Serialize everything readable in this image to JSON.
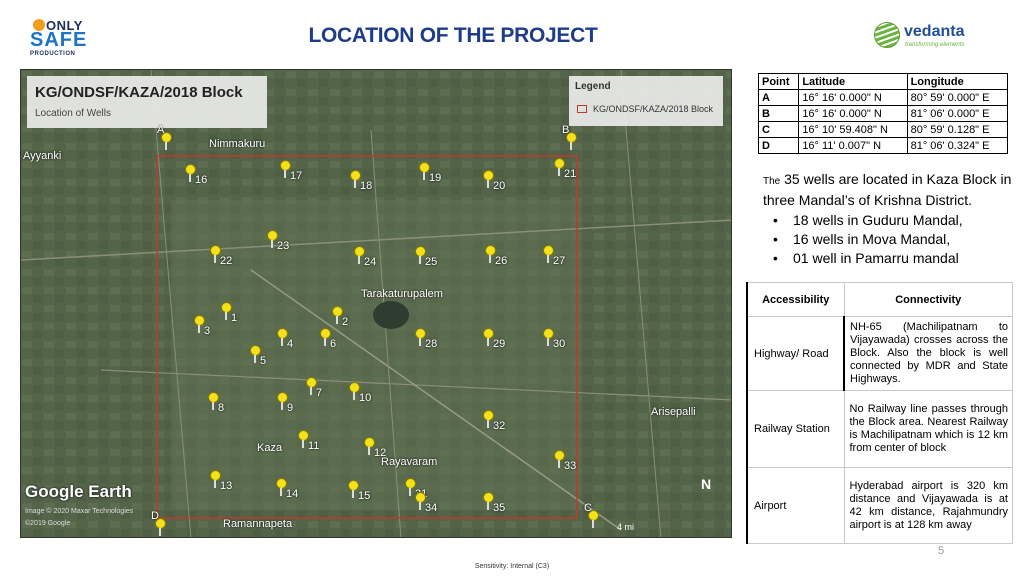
{
  "header": {
    "title": "LOCATION OF THE PROJECT",
    "logo_left": {
      "line1": "ONLY",
      "line2": "SAFE",
      "line3": "PRODUCTION"
    },
    "logo_right": {
      "brand": "vedanta",
      "tagline": "transforming elements"
    }
  },
  "map": {
    "title": "KG/ONDSF/KAZA/2018 Block",
    "subtitle": "Location of Wells",
    "legend_title": "Legend",
    "legend_item": "KG/ONDSF/KAZA/2018 Block",
    "places": [
      "Nimmakuru",
      "Tarakaturupalem",
      "Kaza",
      "Rayavaram",
      "Arisepalli",
      "Ramannapeta",
      "Ayyanki"
    ],
    "corners": [
      "A",
      "B",
      "C",
      "D"
    ],
    "wells": [
      "1",
      "2",
      "3",
      "4",
      "5",
      "6",
      "7",
      "8",
      "9",
      "10",
      "11",
      "12",
      "13",
      "14",
      "15",
      "16",
      "17",
      "18",
      "19",
      "20",
      "21",
      "22",
      "23",
      "24",
      "25",
      "26",
      "27",
      "28",
      "29",
      "30",
      "31",
      "32",
      "33",
      "34",
      "35"
    ],
    "google_earth": "Google Earth",
    "imagery_credit": "Image © 2020 Maxar Technologies",
    "copyright": "©2019 Google",
    "north_label": "N",
    "scale_label": "4 mi"
  },
  "coordinates": {
    "headers": [
      "Point",
      "Latitude",
      "Longitude"
    ],
    "rows": [
      [
        "A",
        "16° 16' 0.000\" N",
        "80° 59' 0.000\" E"
      ],
      [
        "B",
        "16° 16' 0.000\" N",
        "81° 06' 0.000\" E"
      ],
      [
        "C",
        "16° 10' 59.408\" N",
        "80° 59' 0.128\" E"
      ],
      [
        "D",
        "16° 11' 0.007\" N",
        "81° 06' 0.324\" E"
      ]
    ]
  },
  "description": {
    "prefix": "The",
    "text": "35 wells are located in Kaza Block in three Mandal’s of Krishna District.",
    "bullets": [
      "18 wells in Guduru Mandal,",
      "16 wells in Mova Mandal,",
      "01 well in Pamarru mandal"
    ]
  },
  "accessibility": {
    "headers": [
      "Accessibility",
      "Connectivity"
    ],
    "rows": [
      [
        "Highway/ Road",
        "NH-65 (Machilipatnam to Vijayawada) crosses across the Block. Also the block is well connected by MDR and State Highways."
      ],
      [
        "Railway Station",
        "No Railway line passes through the Block area. Nearest Railway is Machilipatnam which is 12 km from center of block"
      ],
      [
        "Airport",
        "Hyderabad airport is 320 km distance and Vijayawada is at 42 km distance, Rajahmundry airport is at 128 km away"
      ]
    ]
  },
  "page_number": "5",
  "footer": "Sensitivity: Internal (C3)"
}
